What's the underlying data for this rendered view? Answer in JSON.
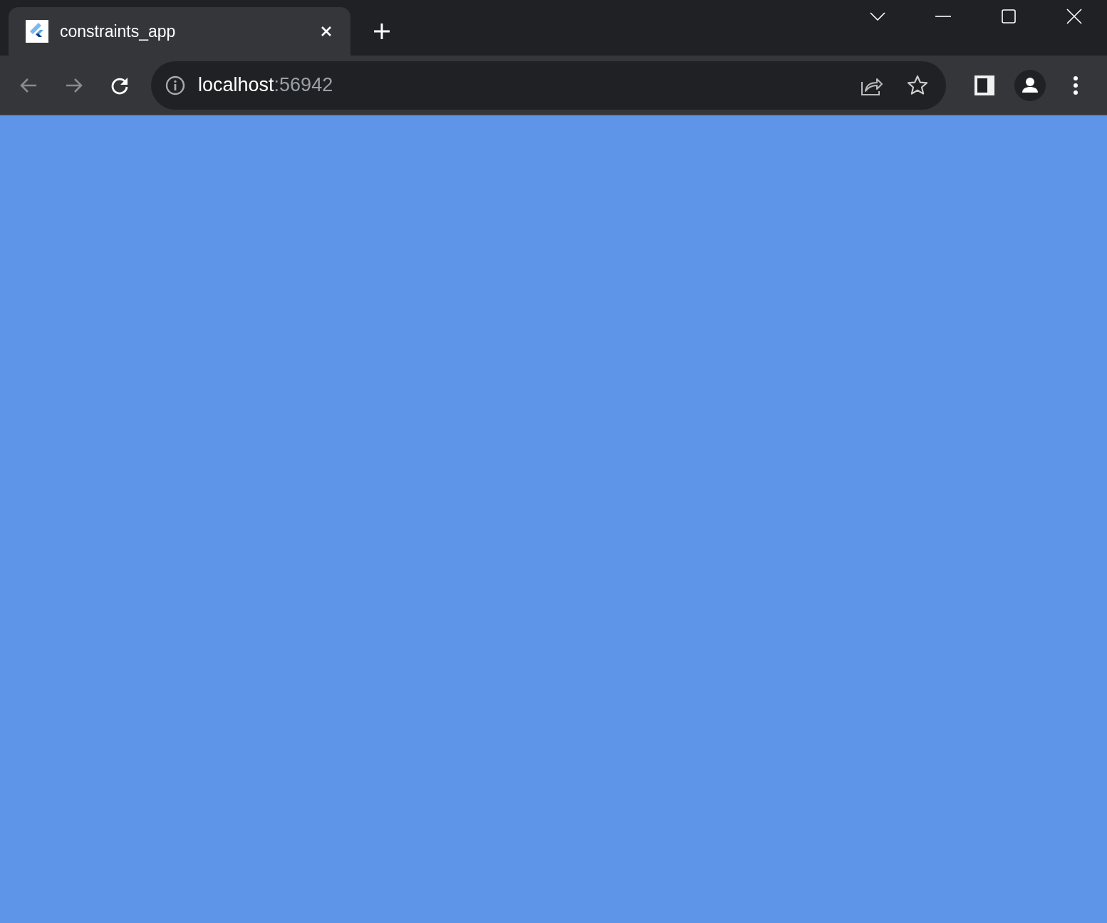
{
  "tabs": [
    {
      "title": "constraints_app",
      "selected": true
    }
  ],
  "toolbar": {
    "back": {
      "disabled": true
    },
    "forward": {
      "disabled": true
    }
  },
  "address_bar": {
    "host": "localhost",
    "port": ":56942"
  }
}
